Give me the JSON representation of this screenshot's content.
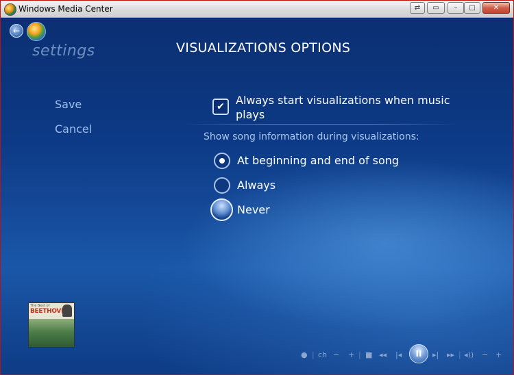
{
  "window": {
    "title": "Windows Media Center",
    "controls": {
      "restore": "⇄",
      "minimize": "–",
      "maximize": "□",
      "close": "✕"
    }
  },
  "header": {
    "back_icon": "←",
    "section": "settings",
    "title": "VISUALIZATIONS OPTIONS"
  },
  "sidebar": {
    "items": [
      {
        "label": "Save"
      },
      {
        "label": "Cancel"
      }
    ]
  },
  "options": {
    "always_start": {
      "checked": true,
      "mark": "✔",
      "label": "Always start visualizations when music plays"
    },
    "song_info_label": "Show song information during visualizations:",
    "radios": [
      {
        "label": "At beginning and end of song",
        "selected": true
      },
      {
        "label": "Always",
        "selected": false
      },
      {
        "label": "Never",
        "selected": false,
        "focused": true
      }
    ]
  },
  "now_playing": {
    "album_top": "The Best of",
    "album_artist": "BEETHOVEN"
  },
  "transport": {
    "record": "●",
    "ch": "ch",
    "ch_down": "−",
    "ch_up": "+",
    "stop": "■",
    "rewind": "◂◂",
    "prev": "|◂",
    "pause": "II",
    "next": "▸|",
    "forward": "▸▸",
    "volume": "◂))",
    "vol_down": "−",
    "vol_up": "+"
  },
  "colors": {
    "background": "#0d3a86",
    "accent": "#9cc0ec",
    "text": "#ffffff"
  }
}
